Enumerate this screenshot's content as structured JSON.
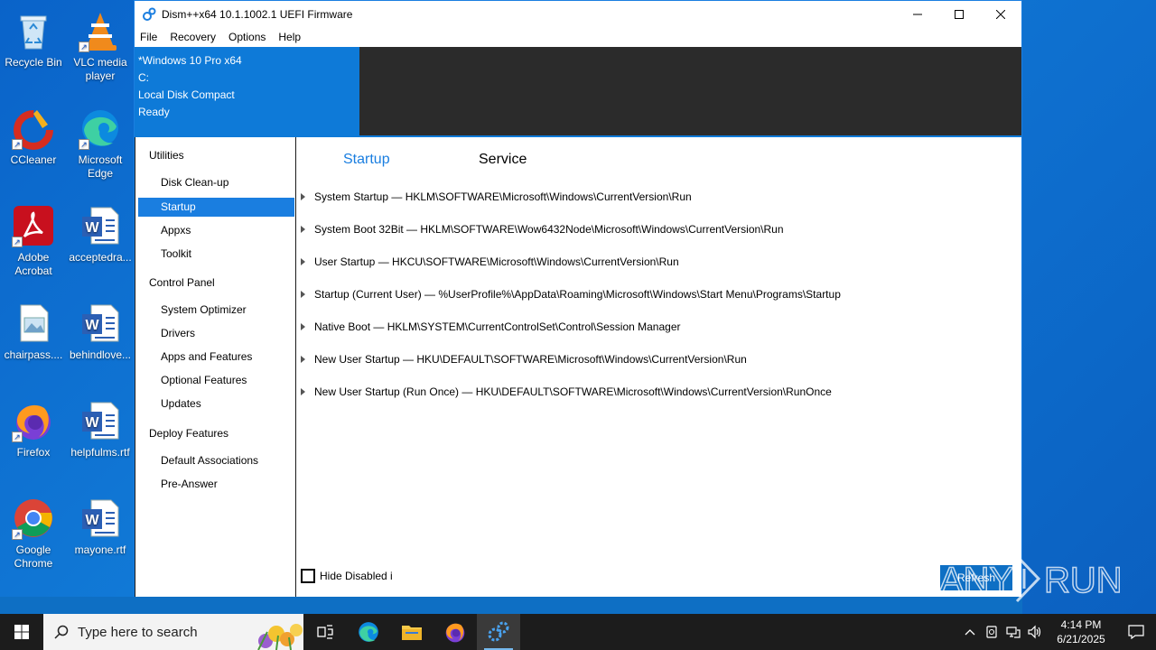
{
  "desktop": {
    "icons": [
      {
        "name": "recycle-bin",
        "label": "Recycle Bin"
      },
      {
        "name": "vlc",
        "label": "VLC media player"
      },
      {
        "name": "ccleaner",
        "label": "CCleaner"
      },
      {
        "name": "edge",
        "label": "Microsoft Edge"
      },
      {
        "name": "acrobat",
        "label": "Adobe Acrobat"
      },
      {
        "name": "acceptedra",
        "label": "acceptedra..."
      },
      {
        "name": "chairpass",
        "label": "chairpass...."
      },
      {
        "name": "behindlove",
        "label": "behindlove..."
      },
      {
        "name": "firefox",
        "label": "Firefox"
      },
      {
        "name": "helpfulms",
        "label": "helpfulms.rtf"
      },
      {
        "name": "chrome",
        "label": "Google Chrome"
      },
      {
        "name": "mayone",
        "label": "mayone.rtf"
      }
    ]
  },
  "window": {
    "title": "Dism++x64 10.1.1002.1 UEFI Firmware",
    "menu": [
      "File",
      "Recovery",
      "Options",
      "Help"
    ],
    "info": [
      "*Windows 10 Pro x64",
      "C:",
      "Local Disk Compact",
      "Ready"
    ],
    "sidebar": {
      "groups": [
        {
          "label": "Utilities",
          "items": [
            "Disk Clean-up",
            "Startup",
            "Appxs",
            "Toolkit"
          ]
        },
        {
          "label": "Control Panel",
          "items": [
            "System Optimizer",
            "Drivers",
            "Apps and Features",
            "Optional Features",
            "Updates"
          ]
        },
        {
          "label": "Deploy Features",
          "items": [
            "Default Associations",
            "Pre-Answer"
          ]
        }
      ],
      "active": "Startup"
    },
    "tabs": {
      "startup": "Startup",
      "service": "Service"
    },
    "rows": [
      "System Startup — HKLM\\SOFTWARE\\Microsoft\\Windows\\CurrentVersion\\Run",
      "System Boot 32Bit — HKLM\\SOFTWARE\\Wow6432Node\\Microsoft\\Windows\\CurrentVersion\\Run",
      "User Startup — HKCU\\SOFTWARE\\Microsoft\\Windows\\CurrentVersion\\Run",
      "Startup (Current User) — %UserProfile%\\AppData\\Roaming\\Microsoft\\Windows\\Start Menu\\Programs\\Startup",
      "Native Boot — HKLM\\SYSTEM\\CurrentControlSet\\Control\\Session Manager",
      "New User Startup — HKU\\DEFAULT\\SOFTWARE\\Microsoft\\Windows\\CurrentVersion\\Run",
      "New User Startup (Run Once) — HKU\\DEFAULT\\SOFTWARE\\Microsoft\\Windows\\CurrentVersion\\RunOnce"
    ],
    "hide_disabled_label": "Hide Disabled i",
    "refresh_label": "Refresh"
  },
  "watermark": {
    "text": "ANY RUN"
  },
  "taskbar": {
    "search_placeholder": "Type here to search",
    "time": "4:14 PM",
    "date": "6/21/2025"
  },
  "colors": {
    "accent": "#1a7ee0",
    "info_panel": "#0e7ad8",
    "dark_panel": "#2b2b2b",
    "taskbar": "#1c1c1c"
  }
}
